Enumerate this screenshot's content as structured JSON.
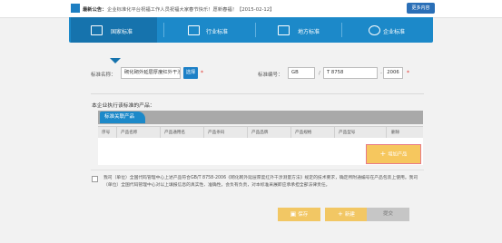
{
  "notice": {
    "label": "最新公告：",
    "text": "企业标准化平台祝福工作人员祝福大家春节快乐！愿新春福！【2015-02-12】",
    "more_label": "更多内容"
  },
  "tabs": [
    {
      "label": "国家标准",
      "active": true
    },
    {
      "label": "行业标准",
      "active": false
    },
    {
      "label": "地方标准",
      "active": false
    },
    {
      "label": "企业标准",
      "active": false
    }
  ],
  "form": {
    "std_name_label": "标准名称：",
    "std_name_value": "砌化砌外延层厚度红外干涉测量方法",
    "select_label": "选择",
    "required_mark": "*",
    "std_code_label": "标准编号：",
    "code_prefix": "GB",
    "code_slash": "/",
    "code_number": "T  8758",
    "code_dash": "-",
    "code_year": "2006"
  },
  "section": {
    "title": "本企业执行该标准的产品："
  },
  "product_table": {
    "panel_title": "标准关联产品",
    "columns": [
      "序号",
      "产品名称",
      "产品通用名",
      "产品条码",
      "产品品牌",
      "产品规格",
      "产品型号",
      "删除"
    ],
    "add_label": "增加产品"
  },
  "agreement": {
    "text": "我司（单位）全国代码管理中心上述产品符合GB/T 8758-2006《砌化砌外延层厚度红外干涉测量方法》规定的技术要求，确定所附通编号在产品包装上使用。我司（单位）全国代码管理中心对以上填报信息的真实性、准确性，会负有负责，对本标准采展即应承承担全部法律责任。"
  },
  "actions": {
    "save_label": "保存",
    "add_label": "新建",
    "submit_label": "提交"
  },
  "colors": {
    "primary": "#1c89c9",
    "accent": "#f2c764",
    "required": "#e0322d"
  }
}
